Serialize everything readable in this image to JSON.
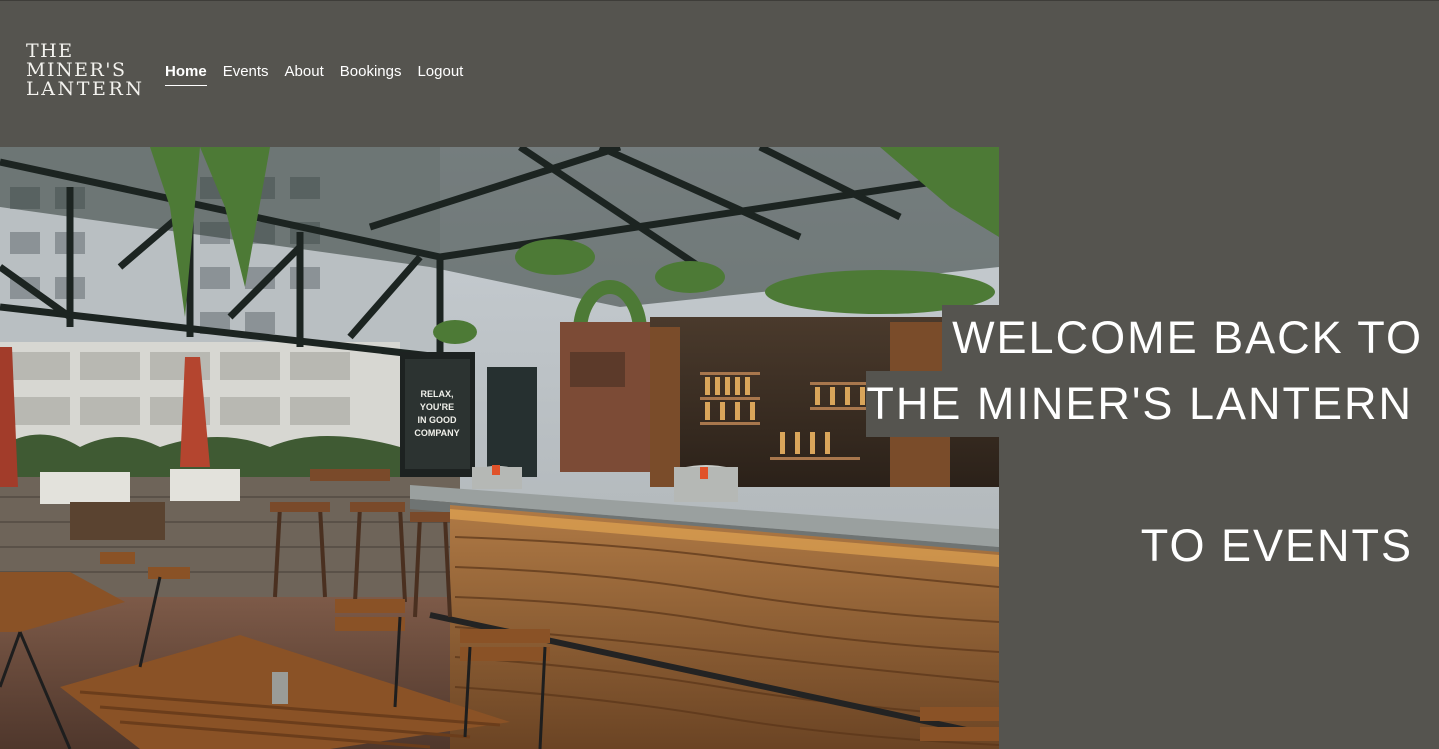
{
  "brand": {
    "logo_lines": [
      "THE",
      "MINER'S",
      "LANTERN"
    ]
  },
  "nav": {
    "items": [
      {
        "label": "Home",
        "active": true
      },
      {
        "label": "Events",
        "active": false
      },
      {
        "label": "About",
        "active": false
      },
      {
        "label": "Bookings",
        "active": false
      },
      {
        "label": "Logout",
        "active": false
      }
    ]
  },
  "hero": {
    "headline_line1": "WELCOME BACK TO",
    "headline_line2": "THE MINER'S LANTERN",
    "cta": "TO EVENTS",
    "sign_lines": [
      "RELAX,",
      "YOU'RE",
      "IN GOOD",
      "COMPANY"
    ]
  },
  "colors": {
    "background": "#55544f",
    "text": "#ffffff"
  }
}
